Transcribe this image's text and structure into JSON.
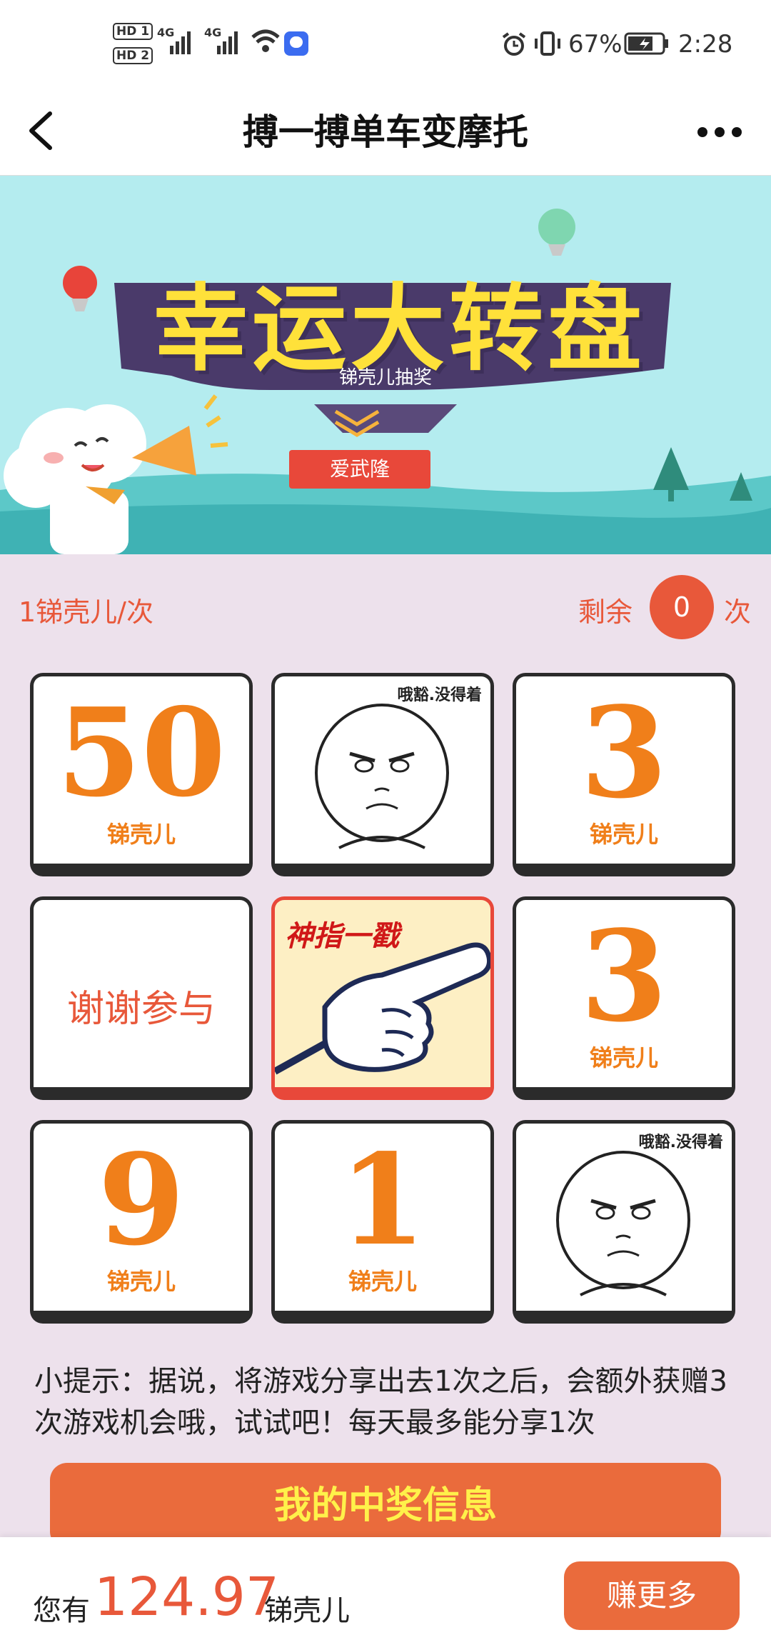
{
  "status_bar": {
    "hd1": "HD 1",
    "hd2": "HD 2",
    "net1": "4G",
    "net2": "4G",
    "battery_percent": "67%",
    "time": "2:28",
    "icons": [
      "signal-icon",
      "wifi-icon",
      "app-notification-icon",
      "alarm-icon",
      "vibrate-icon",
      "battery-charging-icon"
    ]
  },
  "header": {
    "title": "搏一搏单车变摩托",
    "back_icon": "chevron-left-icon",
    "more_icon": "more-dots-icon"
  },
  "banner": {
    "title": "幸运大转盘",
    "subtitle": "锑壳儿抽奖",
    "tag": "爱武隆"
  },
  "game_info": {
    "cost_label": "1锑壳儿/次",
    "remaining_prefix": "剩余",
    "remaining_count": "0",
    "remaining_suffix": "次"
  },
  "grid": {
    "unit": "锑壳儿",
    "meme_caption": "哦豁.没得着",
    "thanks": "谢谢参与",
    "center_text": "神指一戳",
    "values": {
      "p1": "50",
      "p3": "3",
      "p6": "3",
      "p7": "9",
      "p8": "1"
    }
  },
  "tip": "小提示：据说，将游戏分享出去1次之后，会额外获赠3次游戏机会哦，试试吧！每天最多能分享1次",
  "prize_button": "我的中奖信息",
  "bottom": {
    "prefix": "您有",
    "balance": "124.97",
    "suffix": "锑壳儿",
    "earn_button": "赚更多"
  },
  "colors": {
    "accent": "#ea6b3c",
    "number_orange": "#f07f1a",
    "background": "#ede1ec",
    "banner_sky": "#b4ecef",
    "banner_yellow": "#ffe13a"
  }
}
